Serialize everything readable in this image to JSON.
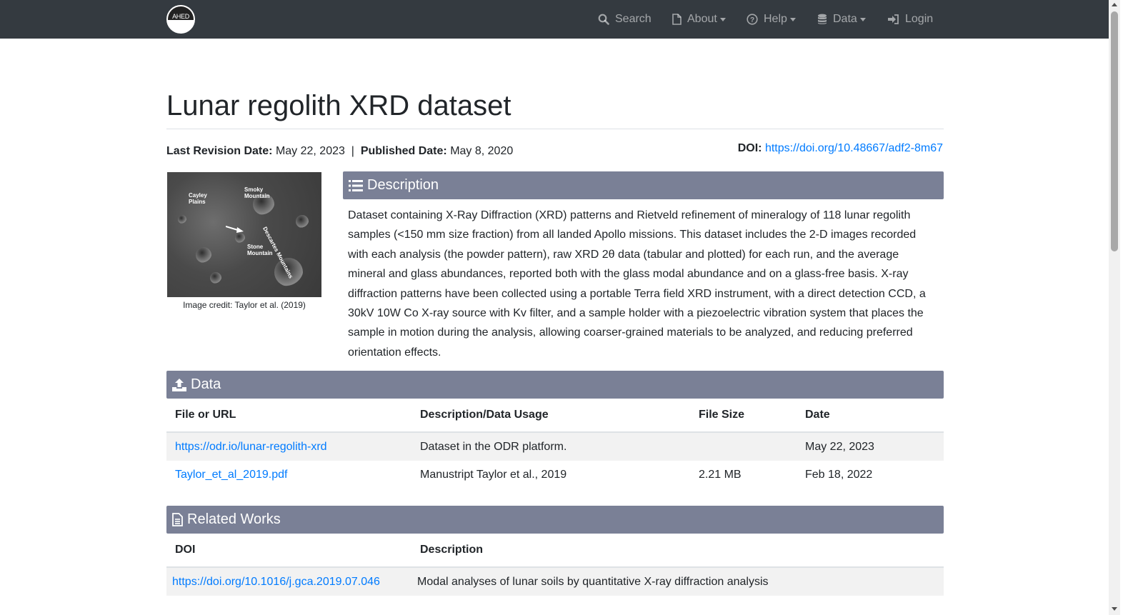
{
  "nav": {
    "logo_text": "AHED",
    "search": "Search",
    "about": "About",
    "help": "Help",
    "data": "Data",
    "login": "Login"
  },
  "page": {
    "title": "Lunar regolith XRD dataset",
    "last_revision_label": "Last Revision Date:",
    "last_revision_value": "May 22, 2023",
    "separator": "|",
    "published_label": "Published Date:",
    "published_value": "May 8, 2020",
    "doi_label": "DOI:",
    "doi_value": "https://doi.org/10.48667/adf2-8m67"
  },
  "image": {
    "labels": [
      "Cayley Plains",
      "Smoky Mountain",
      "Descartes Mountains",
      "Stone Mountain"
    ],
    "credit": "Image credit: Taylor et al. (2019)"
  },
  "description": {
    "heading": "Description",
    "text": "Dataset containing X-Ray Diffraction (XRD) patterns and Rietveld refinement of mineralogy of 118 lunar regolith samples (<150 mm size fraction) from all landed Apollo missions. This dataset includes the 2-D images recorded with each analysis (the powder pattern), raw XRD 2θ data (tabular and plotted) for each run, and the average mineral and glass abundances, reported both with the glass modal abundance and on a glass-free basis. X-ray diffraction patterns have been collected using a portable Terra field XRD instrument, with a direct detection CCD, a 30kV 10W Co X-ray source with Kv filter, and a sample holder with a piezoelectric vibration system that places the sample in motion during the analysis, allowing coarser-grained materials to be analyzed, and reducing preferred orientation effects."
  },
  "data_section": {
    "heading": "Data",
    "columns": [
      "File or URL",
      "Description/Data Usage",
      "File Size",
      "Date"
    ],
    "rows": [
      [
        "https://odr.io/lunar-regolith-xrd",
        "Dataset in the ODR platform.",
        "",
        "May 22, 2023"
      ],
      [
        "Taylor_et_al_2019.pdf",
        "Manustript Taylor et al., 2019",
        "2.21 MB",
        "Feb 18, 2022"
      ]
    ]
  },
  "related": {
    "heading": "Related Works",
    "columns": [
      "DOI",
      "Description"
    ],
    "rows": [
      [
        "https://doi.org/10.1016/j.gca.2019.07.046",
        "Modal analyses of lunar soils by quantitative X-ray diffraction analysis"
      ]
    ]
  },
  "colors": {
    "navbar": "#343a40",
    "panel_header": "#7a8096",
    "link": "#007bff"
  }
}
